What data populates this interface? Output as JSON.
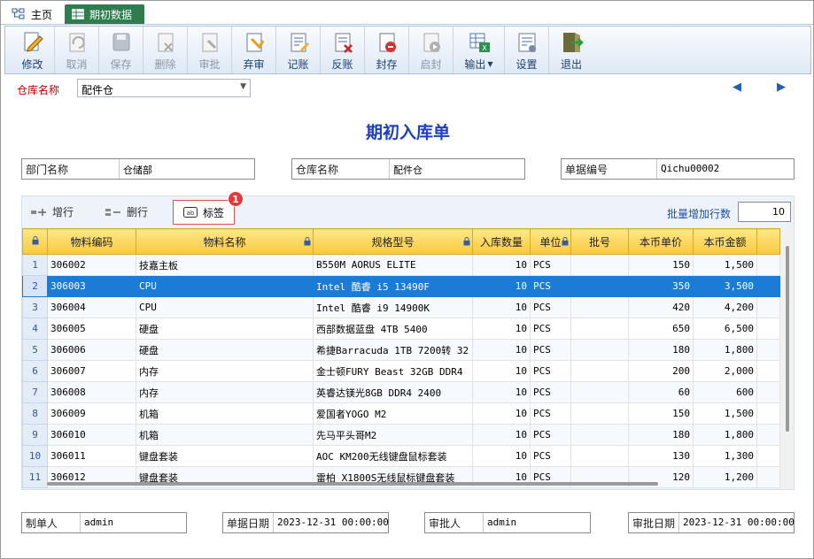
{
  "tabs": {
    "home": "主页",
    "active": "期初数据"
  },
  "toolbar": [
    {
      "label": "修改",
      "icon": "edit-icon",
      "enabled": true
    },
    {
      "label": "取消",
      "icon": "undo-icon",
      "enabled": false
    },
    {
      "label": "保存",
      "icon": "save-icon",
      "enabled": false
    },
    {
      "label": "删除",
      "icon": "delete-icon",
      "enabled": false
    },
    {
      "label": "审批",
      "icon": "approve-icon",
      "enabled": false
    },
    {
      "label": "弃审",
      "icon": "unapprove-icon",
      "enabled": true
    },
    {
      "label": "记账",
      "icon": "post-icon",
      "enabled": true
    },
    {
      "label": "反账",
      "icon": "unpost-icon",
      "enabled": true
    },
    {
      "label": "封存",
      "icon": "seal-icon",
      "enabled": true
    },
    {
      "label": "启封",
      "icon": "unseal-icon",
      "enabled": false
    },
    {
      "label": "输出",
      "icon": "export-icon",
      "enabled": true
    },
    {
      "label": "设置",
      "icon": "settings-icon",
      "enabled": true
    },
    {
      "label": "退出",
      "icon": "exit-icon",
      "enabled": true
    }
  ],
  "warehouse": {
    "label": "仓库名称",
    "value": "配件仓"
  },
  "title": "期初入库单",
  "header": {
    "dept_label": "部门名称",
    "dept_value": "仓储部",
    "wh_label": "仓库名称",
    "wh_value": "配件仓",
    "no_label": "单据编号",
    "no_value": "Qichu00002"
  },
  "grid_toolbar": {
    "add": "增行",
    "delete": "删行",
    "label": "标签",
    "badge": "1",
    "batch_label": "批量增加行数",
    "batch_value": "10"
  },
  "columns": [
    "物料编码",
    "物料名称",
    "规格型号",
    "入库数量",
    "单位",
    "批号",
    "本币单价",
    "本币金额"
  ],
  "rows": [
    {
      "n": "1",
      "code": "306002",
      "name": "技嘉主板",
      "spec": "B550M AORUS ELITE",
      "qty": "10",
      "unit": "PCS",
      "batch": "",
      "price": "150",
      "amount": "1,500"
    },
    {
      "n": "2",
      "code": "306003",
      "name": "CPU",
      "spec": "Intel 酷睿 i5 13490F",
      "qty": "10",
      "unit": "PCS",
      "batch": "",
      "price": "350",
      "amount": "3,500"
    },
    {
      "n": "3",
      "code": "306004",
      "name": "CPU",
      "spec": "Intel 酷睿 i9 14900K",
      "qty": "10",
      "unit": "PCS",
      "batch": "",
      "price": "420",
      "amount": "4,200"
    },
    {
      "n": "4",
      "code": "306005",
      "name": "硬盘",
      "spec": "西部数据蓝盘 4TB 5400",
      "qty": "10",
      "unit": "PCS",
      "batch": "",
      "price": "650",
      "amount": "6,500"
    },
    {
      "n": "5",
      "code": "306006",
      "name": "硬盘",
      "spec": "希捷Barracuda 1TB 7200转 32",
      "qty": "10",
      "unit": "PCS",
      "batch": "",
      "price": "180",
      "amount": "1,800"
    },
    {
      "n": "6",
      "code": "306007",
      "name": "内存",
      "spec": "金士顿FURY Beast 32GB DDR4",
      "qty": "10",
      "unit": "PCS",
      "batch": "",
      "price": "200",
      "amount": "2,000"
    },
    {
      "n": "7",
      "code": "306008",
      "name": "内存",
      "spec": "英睿达镁光8GB DDR4 2400",
      "qty": "10",
      "unit": "PCS",
      "batch": "",
      "price": "60",
      "amount": "600"
    },
    {
      "n": "8",
      "code": "306009",
      "name": "机箱",
      "spec": "爱国者YOGO M2",
      "qty": "10",
      "unit": "PCS",
      "batch": "",
      "price": "150",
      "amount": "1,500"
    },
    {
      "n": "9",
      "code": "306010",
      "name": "机箱",
      "spec": "先马平头哥M2",
      "qty": "10",
      "unit": "PCS",
      "batch": "",
      "price": "180",
      "amount": "1,800"
    },
    {
      "n": "10",
      "code": "306011",
      "name": "键盘套装",
      "spec": "AOC KM200无线键盘鼠标套装",
      "qty": "10",
      "unit": "PCS",
      "batch": "",
      "price": "130",
      "amount": "1,300"
    },
    {
      "n": "11",
      "code": "306012",
      "name": "键盘套装",
      "spec": "雷柏 X1800S无线鼠标键盘套装",
      "qty": "10",
      "unit": "PCS",
      "batch": "",
      "price": "120",
      "amount": "1,200"
    }
  ],
  "footer": {
    "maker_label": "制单人",
    "maker_value": "admin",
    "date_label": "单据日期",
    "date_value": "2023-12-31 00:00:00",
    "approver_label": "审批人",
    "approver_value": "admin",
    "approve_date_label": "审批日期",
    "approve_date_value": "2023-12-31 00:00:00"
  }
}
